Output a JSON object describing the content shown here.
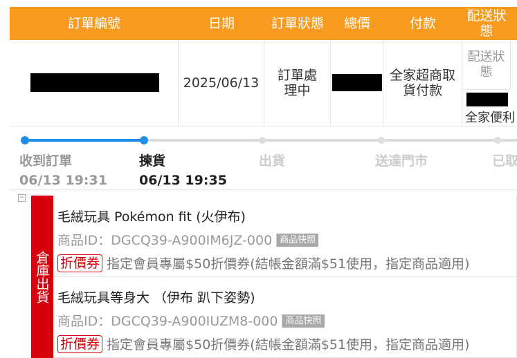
{
  "table": {
    "headers": {
      "order_no": "訂單編號",
      "date": "日期",
      "status": "訂單狀態",
      "total": "總價",
      "payment": "付款",
      "shipping": "配送狀態"
    },
    "row": {
      "date": "2025/06/13",
      "status": "訂單處理中",
      "payment": "全家超商取貨付款",
      "shipping_status_label": "配送狀態",
      "shipping_store": "全家便利"
    }
  },
  "progress": {
    "steps": [
      {
        "label": "收到訂單",
        "time": "06/13 19:31"
      },
      {
        "label": "揀貨",
        "time": "06/13 19:35"
      },
      {
        "label": "出貨",
        "time": ""
      },
      {
        "label": "送達門市",
        "time": ""
      },
      {
        "label": "已取",
        "time": ""
      }
    ],
    "completed_steps": 2
  },
  "warehouse": {
    "tag": "倉庫出貨"
  },
  "items": [
    {
      "name": "毛絨玩具 Pokémon fit (火伊布)",
      "id": "商品ID：DGCQ39-A900IM6JZ-000",
      "snapshot": "商品快照",
      "coupon_badge": "折價券",
      "coupon_text": "指定會員專屬$50折價券(結帳金額滿$51使用，指定商品適用)"
    },
    {
      "name": "毛絨玩具等身大 （伊布 趴下姿勢)",
      "id": "商品ID：DGCQ39-A900IUZM8-000",
      "snapshot": "商品快照",
      "coupon_badge": "折價券",
      "coupon_text": "指定會員專屬$50折價券(結帳金額滿$51使用，指定商品適用)"
    }
  ],
  "colors": {
    "header_bg": "#f79a1d",
    "progress_done": "#1f8ee8",
    "warehouse_tag": "#d9000d"
  }
}
